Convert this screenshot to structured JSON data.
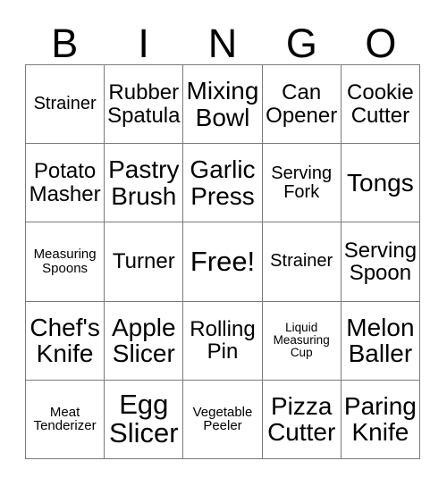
{
  "card": {
    "header_letters": [
      "B",
      "I",
      "N",
      "G",
      "O"
    ],
    "rows": [
      [
        {
          "text": "Strainer",
          "size": "sm"
        },
        {
          "text": "Rubber\nSpatula",
          "size": "md"
        },
        {
          "text": "Mixing\nBowl",
          "size": "lg"
        },
        {
          "text": "Can\nOpener",
          "size": "md"
        },
        {
          "text": "Cookie\nCutter",
          "size": "md"
        }
      ],
      [
        {
          "text": "Potato\nMasher",
          "size": "md"
        },
        {
          "text": "Pastry\nBrush",
          "size": "lg"
        },
        {
          "text": "Garlic\nPress",
          "size": "lg"
        },
        {
          "text": "Serving\nFork",
          "size": "sm"
        },
        {
          "text": "Tongs",
          "size": "lg"
        }
      ],
      [
        {
          "text": "Measuring\nSpoons",
          "size": "xs"
        },
        {
          "text": "Turner",
          "size": "md"
        },
        {
          "text": "Free!",
          "size": "xl"
        },
        {
          "text": "Strainer",
          "size": "sm"
        },
        {
          "text": "Serving\nSpoon",
          "size": "md"
        }
      ],
      [
        {
          "text": "Chef's\nKnife",
          "size": "lg"
        },
        {
          "text": "Apple\nSlicer",
          "size": "lg"
        },
        {
          "text": "Rolling\nPin",
          "size": "md"
        },
        {
          "text": "Liquid\nMeasuring\nCup",
          "size": "xxs"
        },
        {
          "text": "Melon\nBaller",
          "size": "lg"
        }
      ],
      [
        {
          "text": "Meat\nTenderizer",
          "size": "xs"
        },
        {
          "text": "Egg\nSlicer",
          "size": "xl"
        },
        {
          "text": "Vegetable\nPeeler",
          "size": "xs"
        },
        {
          "text": "Pizza\nCutter",
          "size": "lg"
        },
        {
          "text": "Paring\nKnife",
          "size": "lg"
        }
      ]
    ]
  },
  "colors": {
    "background": "#ffffff",
    "text": "#000000",
    "grid_line": "#7a7a7a"
  }
}
